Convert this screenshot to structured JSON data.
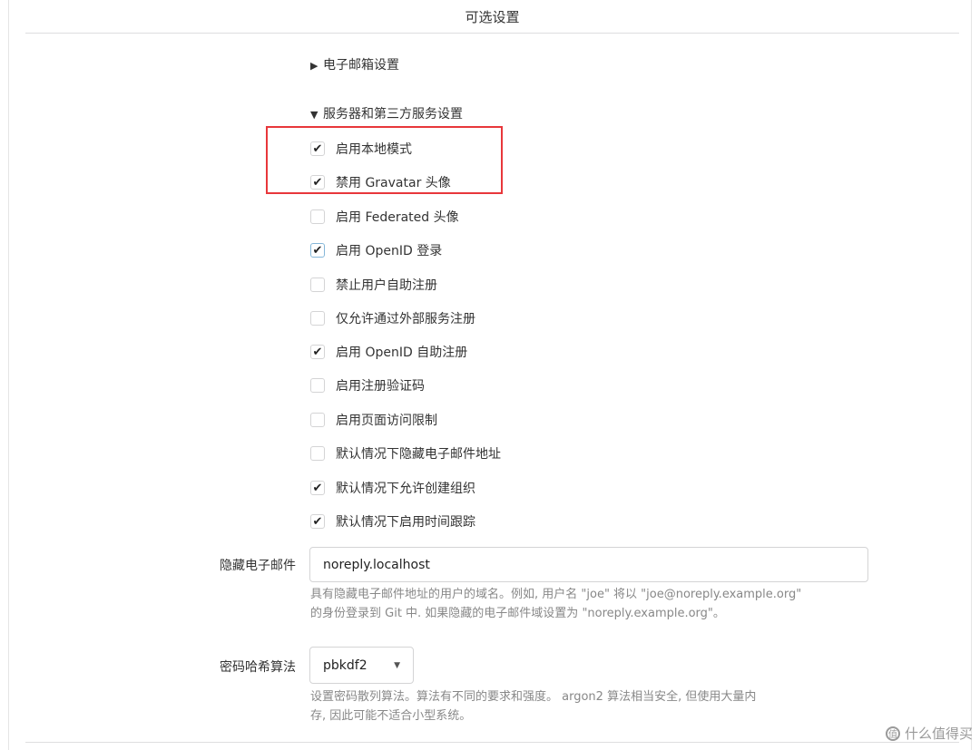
{
  "section_title": "可选设置",
  "email_settings": {
    "arrow": "▶",
    "label": "电子邮箱设置"
  },
  "server_settings": {
    "arrow": "▼",
    "label": "服务器和第三方服务设置"
  },
  "options": [
    {
      "label": "启用本地模式",
      "checked": true
    },
    {
      "label": "禁用 Gravatar 头像",
      "checked": true
    },
    {
      "label": "启用 Federated 头像",
      "checked": false
    },
    {
      "label": "启用 OpenID 登录",
      "checked": true
    },
    {
      "label": "禁止用户自助注册",
      "checked": false
    },
    {
      "label": "仅允许通过外部服务注册",
      "checked": false
    },
    {
      "label": "启用 OpenID 自助注册",
      "checked": true
    },
    {
      "label": "启用注册验证码",
      "checked": false
    },
    {
      "label": "启用页面访问限制",
      "checked": false
    },
    {
      "label": "默认情况下隐藏电子邮件地址",
      "checked": false
    },
    {
      "label": "默认情况下允许创建组织",
      "checked": true
    },
    {
      "label": "默认情况下启用时间跟踪",
      "checked": true
    }
  ],
  "hidden_email": {
    "label": "隐藏电子邮件",
    "value": "noreply.localhost",
    "help_line1": "具有隐藏电子邮件地址的用户的域名。例如, 用户名 \"joe\" 将以 \"joe@noreply.example.org\"",
    "help_line2": "的身份登录到 Git 中. 如果隐藏的电子邮件域设置为 \"noreply.example.org\"。"
  },
  "password_hash": {
    "label": "密码哈希算法",
    "selected": "pbkdf2",
    "help_line1": "设置密码散列算法。算法有不同的要求和强度。 argon2 算法相当安全, 但使用大量内",
    "help_line2": "存, 因此可能不适合小型系统。"
  },
  "watermark": "什么值得买",
  "colors": {
    "highlight": "#e8373b",
    "border": "#d4d4d5",
    "help_text": "#888888"
  }
}
